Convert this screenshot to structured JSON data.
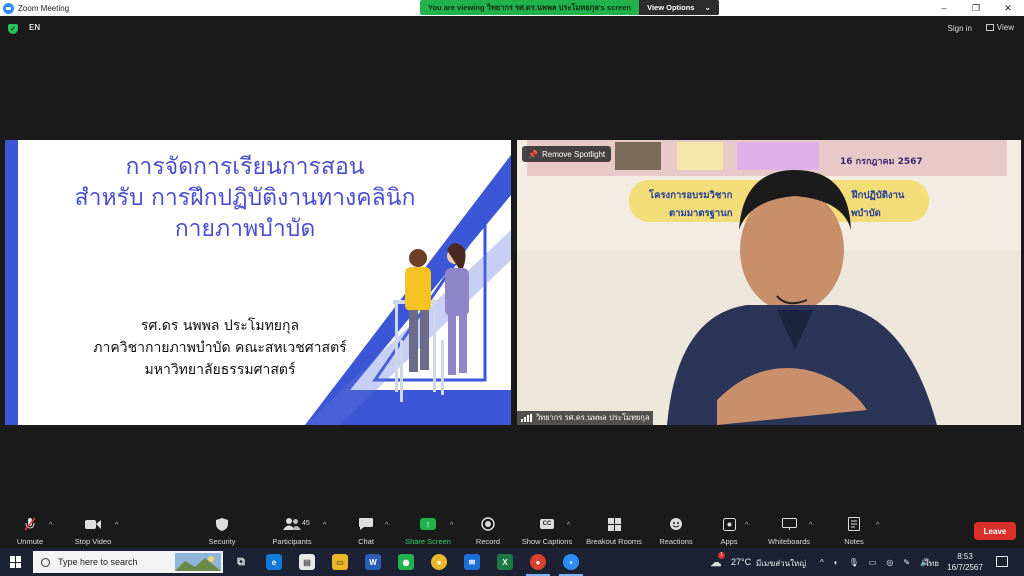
{
  "window": {
    "app_title": "Zoom Meeting",
    "share_text": "You are viewing วิทยากร รศ.ดร.นพพล ประโมทยกุล's screen",
    "view_options": "View Options",
    "controls": [
      "–",
      "❐",
      "✕"
    ]
  },
  "top": {
    "lang": "EN",
    "signin": "Sign in",
    "view": "View"
  },
  "slide": {
    "title_lines": [
      "การจัดการเรียนการสอน",
      "สำหรับ การฝึกปฏิบัติงานทางคลินิก",
      "กายภาพบำบัด"
    ],
    "author_lines": [
      "รศ.ดร นพพล ประโมทยกุล",
      "ภาควิชากายภาพบำบัด คณะสหเวชศาสตร์",
      "มหาวิทยาลัยธรรมศาสตร์"
    ]
  },
  "speaker": {
    "remove_spotlight": "Remove Spotlight",
    "banner_date": "16 กรกฎาคม 2567",
    "banner_line1": "โครงการอบรมวิชาก",
    "banner_line1b": "ฝึกปฏิบัติงาน",
    "banner_line2": "ตามมาตรฐานก",
    "banner_line2b": "พบำบัด",
    "name": "วิทยากร รศ.ดร.นพพล ประโมทยกุล"
  },
  "toolbar": {
    "unmute": "Unmute",
    "stop_video": "Stop Video",
    "security": "Security",
    "participants": "Participants",
    "participants_count": "45",
    "chat": "Chat",
    "share_screen": "Share Screen",
    "record": "Record",
    "show_captions": "Show Captions",
    "breakout_rooms": "Breakout Rooms",
    "reactions": "Reactions",
    "apps": "Apps",
    "whiteboards": "Whiteboards",
    "notes": "Notes",
    "leave": "Leave",
    "cc": "CC"
  },
  "taskbar": {
    "search_placeholder": "Type here to search",
    "temperature": "27°C",
    "weather": "มีเมฆส่วนใหญ่",
    "language": "ไทย",
    "time": "8:53",
    "date": "16/7/2567",
    "weather_badge": "1",
    "excel_letter": "X",
    "word_letter": "W"
  }
}
